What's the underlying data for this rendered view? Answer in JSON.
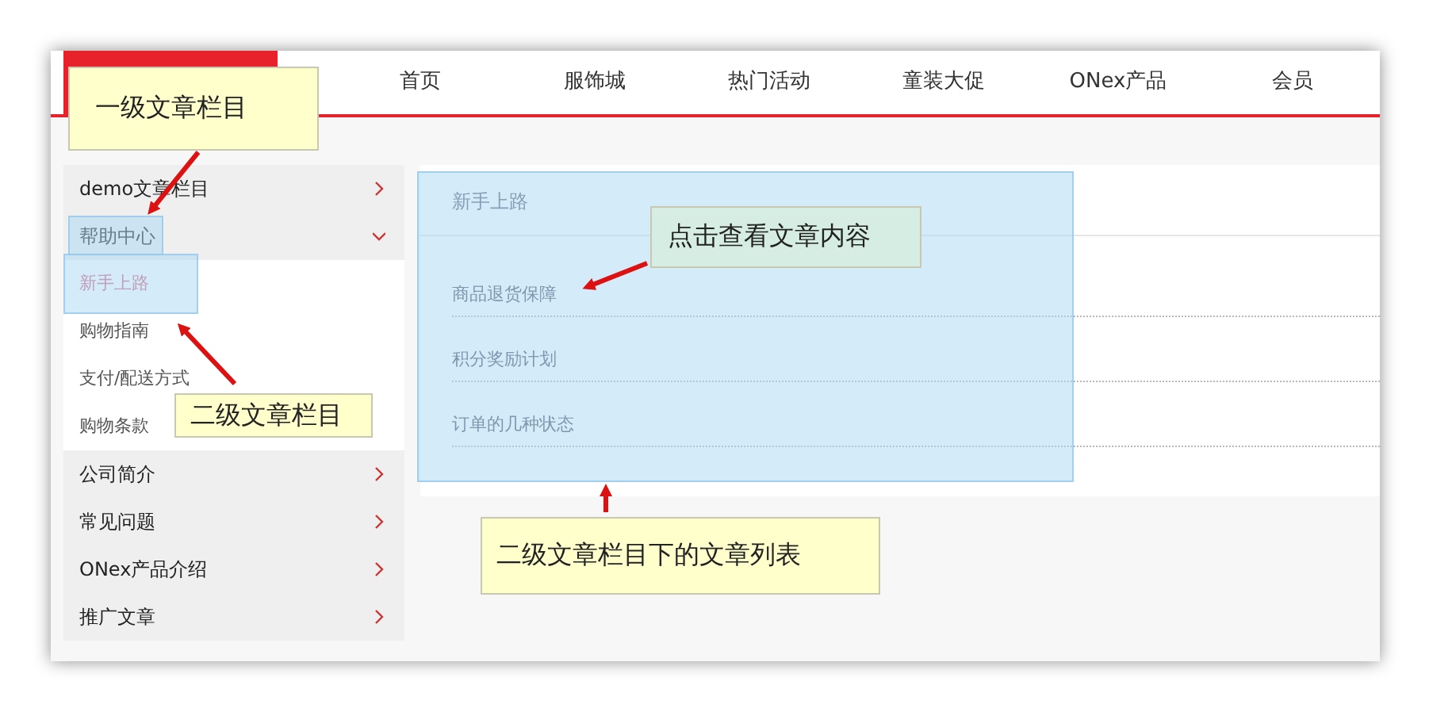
{
  "nav": {
    "items": [
      {
        "label": "首页"
      },
      {
        "label": "服饰城"
      },
      {
        "label": "热门活动"
      },
      {
        "label": "童装大促"
      },
      {
        "label": "ONex产品"
      },
      {
        "label": "会员"
      }
    ]
  },
  "sidebar": {
    "items": [
      {
        "label": "demo文章栏目",
        "expanded": false
      },
      {
        "label": "帮助中心",
        "expanded": true,
        "children": [
          {
            "label": "新手上路",
            "selected": true
          },
          {
            "label": "购物指南",
            "selected": false
          },
          {
            "label": "支付/配送方式",
            "selected": false
          },
          {
            "label": "购物条款",
            "selected": false
          }
        ]
      },
      {
        "label": "公司简介",
        "expanded": false
      },
      {
        "label": "常见问题",
        "expanded": false
      },
      {
        "label": "ONex产品介绍",
        "expanded": false
      },
      {
        "label": "推广文章",
        "expanded": false
      }
    ]
  },
  "content": {
    "title": "新手上路",
    "articles": [
      "商品退货保障",
      "积分奖励计划",
      "订单的几种状态"
    ]
  },
  "annotations": [
    {
      "text": "一级文章栏目",
      "color": "#ffffcc"
    },
    {
      "text": "点击查看文章内容",
      "color": "#d5ede2"
    },
    {
      "text": "二级文章栏目",
      "color": "#ffffcc"
    },
    {
      "text": "二级文章栏目下的文章列表",
      "color": "#ffffcc"
    }
  ]
}
